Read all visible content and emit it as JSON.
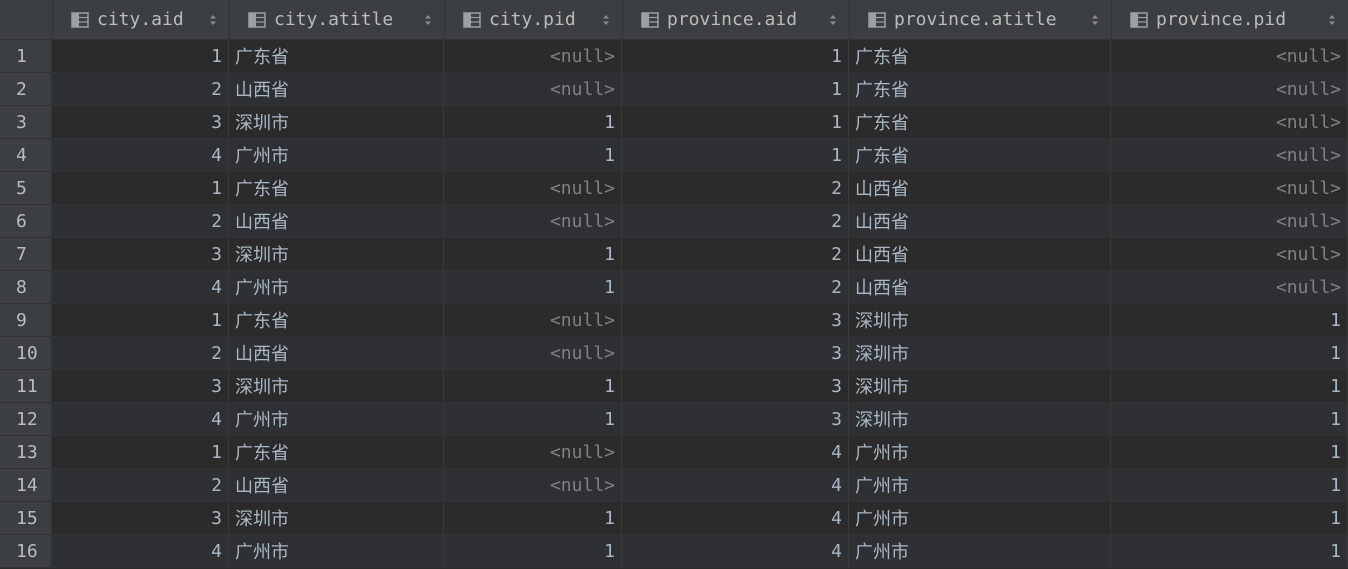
{
  "table": {
    "columns": [
      {
        "label": "city.aid",
        "type": "num",
        "icon": "table-column-icon"
      },
      {
        "label": "city.atitle",
        "type": "txt",
        "icon": "table-column-icon"
      },
      {
        "label": "city.pid",
        "type": "num",
        "icon": "table-column-icon"
      },
      {
        "label": "province.aid",
        "type": "num",
        "icon": "table-column-icon"
      },
      {
        "label": "province.atitle",
        "type": "txt",
        "icon": "table-column-icon"
      },
      {
        "label": "province.pid",
        "type": "num",
        "icon": "table-column-icon"
      }
    ],
    "null_text": "<null>",
    "rows": [
      {
        "n": "1",
        "cells": [
          "1",
          "广东省",
          null,
          "1",
          "广东省",
          null
        ]
      },
      {
        "n": "2",
        "cells": [
          "2",
          "山西省",
          null,
          "1",
          "广东省",
          null
        ]
      },
      {
        "n": "3",
        "cells": [
          "3",
          "深圳市",
          "1",
          "1",
          "广东省",
          null
        ]
      },
      {
        "n": "4",
        "cells": [
          "4",
          "广州市",
          "1",
          "1",
          "广东省",
          null
        ]
      },
      {
        "n": "5",
        "cells": [
          "1",
          "广东省",
          null,
          "2",
          "山西省",
          null
        ]
      },
      {
        "n": "6",
        "cells": [
          "2",
          "山西省",
          null,
          "2",
          "山西省",
          null
        ]
      },
      {
        "n": "7",
        "cells": [
          "3",
          "深圳市",
          "1",
          "2",
          "山西省",
          null
        ]
      },
      {
        "n": "8",
        "cells": [
          "4",
          "广州市",
          "1",
          "2",
          "山西省",
          null
        ]
      },
      {
        "n": "9",
        "cells": [
          "1",
          "广东省",
          null,
          "3",
          "深圳市",
          "1"
        ]
      },
      {
        "n": "10",
        "cells": [
          "2",
          "山西省",
          null,
          "3",
          "深圳市",
          "1"
        ]
      },
      {
        "n": "11",
        "cells": [
          "3",
          "深圳市",
          "1",
          "3",
          "深圳市",
          "1"
        ]
      },
      {
        "n": "12",
        "cells": [
          "4",
          "广州市",
          "1",
          "3",
          "深圳市",
          "1"
        ]
      },
      {
        "n": "13",
        "cells": [
          "1",
          "广东省",
          null,
          "4",
          "广州市",
          "1"
        ]
      },
      {
        "n": "14",
        "cells": [
          "2",
          "山西省",
          null,
          "4",
          "广州市",
          "1"
        ]
      },
      {
        "n": "15",
        "cells": [
          "3",
          "深圳市",
          "1",
          "4",
          "广州市",
          "1"
        ]
      },
      {
        "n": "16",
        "cells": [
          "4",
          "广州市",
          "1",
          "4",
          "广州市",
          "1"
        ]
      }
    ]
  }
}
